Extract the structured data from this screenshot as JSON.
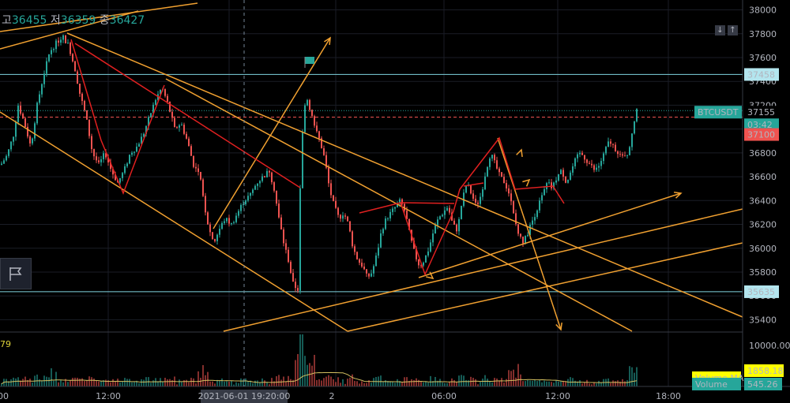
{
  "ohlc": {
    "high_label": "고",
    "high": "36455",
    "low_label": "저",
    "low": "36359",
    "close_label": "종",
    "close": "36427"
  },
  "volume_tag": "79",
  "price_tags": {
    "upper_level": "37458",
    "symbol": "BTCUSDT",
    "last_price": "37155",
    "countdown": "03:42",
    "red_level": "37100",
    "lower_level": "35635"
  },
  "volume_tags": {
    "volume_ma_label": "Volume MA",
    "volume_ma": "1858.18",
    "volume_label": "Volume",
    "volume": "545.26"
  },
  "crosshair_time": "2021-06-01 19:20:00",
  "colors": {
    "up": "#26a69a",
    "down": "#ef5350",
    "orange": "#f0a030",
    "drawing_red": "#e02020",
    "cyan": "#7fd4e0",
    "yellow": "#ffff00"
  },
  "icons": [
    "flag-icon",
    "down-arrow-icon",
    "up-arrow-icon",
    "small-flag-icon"
  ],
  "chart_data": {
    "type": "candlestick",
    "symbol": "BTCUSDT",
    "y_ticks": [
      38000,
      37800,
      37600,
      37400,
      37200,
      37000,
      36800,
      36600,
      36400,
      36200,
      36000,
      35800,
      35600,
      35400
    ],
    "ylim": [
      35330,
      38030
    ],
    "x_tick_labels": [
      "00",
      "12:00",
      "2",
      "06:00",
      "12:00",
      "18:00"
    ],
    "horizontal_levels": [
      {
        "price": 37458,
        "color": "cyan"
      },
      {
        "price": 37155,
        "color": "up",
        "style": "dotted"
      },
      {
        "price": 37100,
        "color": "down",
        "style": "dashed"
      },
      {
        "price": 35635,
        "color": "cyan"
      }
    ],
    "price_path": [
      [
        0,
        36700
      ],
      [
        8,
        36780
      ],
      [
        16,
        36950
      ],
      [
        22,
        37200
      ],
      [
        30,
        37050
      ],
      [
        38,
        36850
      ],
      [
        46,
        37200
      ],
      [
        54,
        37450
      ],
      [
        62,
        37650
      ],
      [
        70,
        37720
      ],
      [
        78,
        37780
      ],
      [
        86,
        37700
      ],
      [
        94,
        37500
      ],
      [
        100,
        37300
      ],
      [
        108,
        37100
      ],
      [
        116,
        36800
      ],
      [
        124,
        36700
      ],
      [
        132,
        36800
      ],
      [
        140,
        36650
      ],
      [
        148,
        36550
      ],
      [
        156,
        36650
      ],
      [
        164,
        36800
      ],
      [
        172,
        36850
      ],
      [
        180,
        36950
      ],
      [
        188,
        37100
      ],
      [
        196,
        37250
      ],
      [
        204,
        37350
      ],
      [
        212,
        37200
      ],
      [
        220,
        37000
      ],
      [
        228,
        37050
      ],
      [
        236,
        36900
      ],
      [
        244,
        36700
      ],
      [
        252,
        36600
      ],
      [
        258,
        36350
      ],
      [
        264,
        36150
      ],
      [
        270,
        36050
      ],
      [
        276,
        36150
      ],
      [
        284,
        36250
      ],
      [
        292,
        36200
      ],
      [
        300,
        36300
      ],
      [
        308,
        36400
      ],
      [
        316,
        36450
      ],
      [
        324,
        36550
      ],
      [
        332,
        36600
      ],
      [
        340,
        36650
      ],
      [
        346,
        36500
      ],
      [
        352,
        36250
      ],
      [
        358,
        36050
      ],
      [
        364,
        35900
      ],
      [
        370,
        35700
      ],
      [
        376,
        35650
      ],
      [
        380,
        36800
      ],
      [
        386,
        37300
      ],
      [
        392,
        37150
      ],
      [
        398,
        37000
      ],
      [
        404,
        36900
      ],
      [
        410,
        36750
      ],
      [
        416,
        36500
      ],
      [
        422,
        36350
      ],
      [
        428,
        36250
      ],
      [
        434,
        36300
      ],
      [
        440,
        36200
      ],
      [
        446,
        36000
      ],
      [
        452,
        35900
      ],
      [
        458,
        35850
      ],
      [
        464,
        35750
      ],
      [
        470,
        35800
      ],
      [
        476,
        35950
      ],
      [
        482,
        36150
      ],
      [
        488,
        36250
      ],
      [
        494,
        36300
      ],
      [
        500,
        36350
      ],
      [
        506,
        36400
      ],
      [
        512,
        36300
      ],
      [
        518,
        36100
      ],
      [
        524,
        35950
      ],
      [
        530,
        35850
      ],
      [
        536,
        35900
      ],
      [
        542,
        36000
      ],
      [
        548,
        36150
      ],
      [
        554,
        36250
      ],
      [
        560,
        36300
      ],
      [
        566,
        36350
      ],
      [
        572,
        36200
      ],
      [
        578,
        36150
      ],
      [
        584,
        36400
      ],
      [
        590,
        36550
      ],
      [
        596,
        36450
      ],
      [
        602,
        36350
      ],
      [
        608,
        36450
      ],
      [
        614,
        36650
      ],
      [
        620,
        36800
      ],
      [
        626,
        36700
      ],
      [
        632,
        36600
      ],
      [
        638,
        36550
      ],
      [
        644,
        36450
      ],
      [
        650,
        36250
      ],
      [
        656,
        36100
      ],
      [
        662,
        36050
      ],
      [
        668,
        36150
      ],
      [
        674,
        36250
      ],
      [
        680,
        36350
      ],
      [
        686,
        36450
      ],
      [
        692,
        36550
      ],
      [
        698,
        36500
      ],
      [
        704,
        36600
      ],
      [
        710,
        36650
      ],
      [
        716,
        36550
      ],
      [
        722,
        36650
      ],
      [
        728,
        36750
      ],
      [
        734,
        36800
      ],
      [
        740,
        36750
      ],
      [
        746,
        36700
      ],
      [
        752,
        36650
      ],
      [
        758,
        36700
      ],
      [
        764,
        36800
      ],
      [
        770,
        36900
      ],
      [
        776,
        36850
      ],
      [
        782,
        36800
      ],
      [
        788,
        36750
      ],
      [
        794,
        36800
      ],
      [
        800,
        37000
      ],
      [
        805,
        37150
      ]
    ]
  }
}
